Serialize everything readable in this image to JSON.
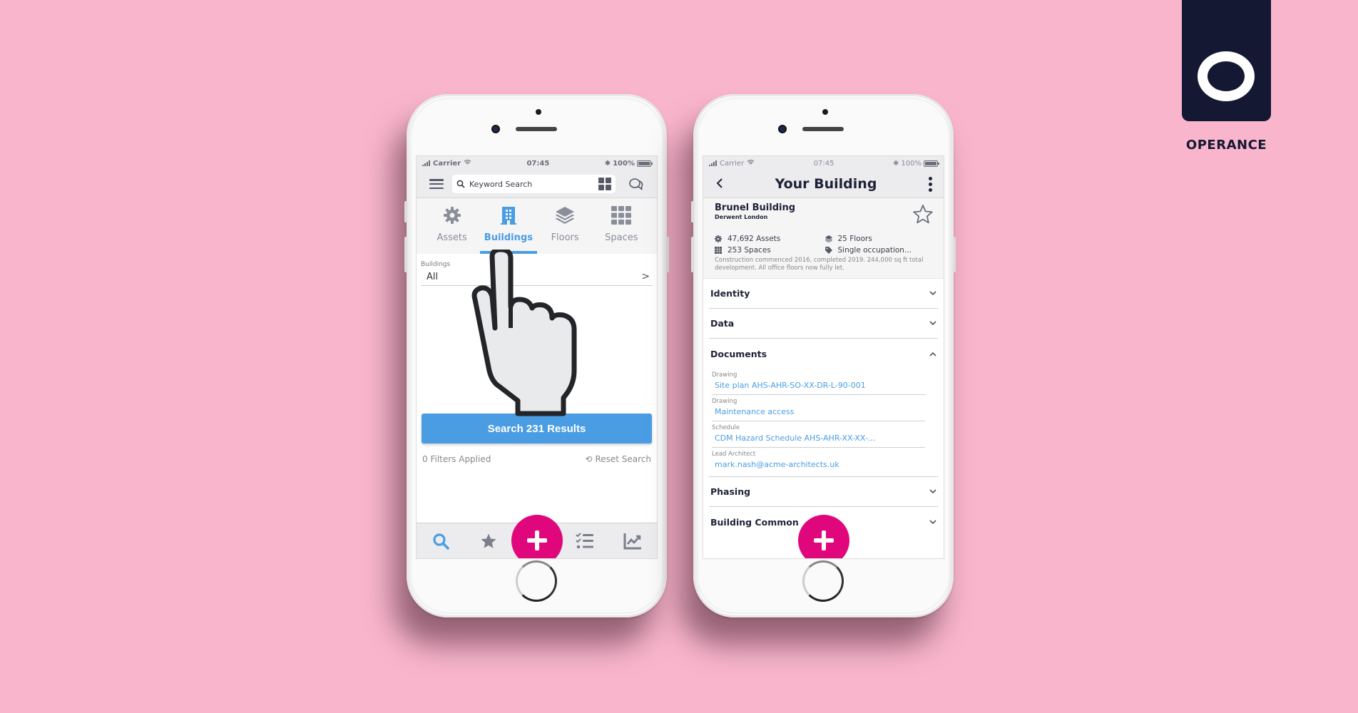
{
  "brand": {
    "name": "OPERANCE",
    "logo_color": "#141833",
    "background_color": "#f8b5cc"
  },
  "colors": {
    "accent": "#4a9de3",
    "fab": "#e0077d",
    "text_dark": "#1e2236"
  },
  "status_bar": {
    "carrier": "Carrier",
    "time": "07:45",
    "battery": "100%"
  },
  "left_phone": {
    "search": {
      "placeholder": "Keyword Search"
    },
    "category_tabs": [
      {
        "label": "Assets",
        "icon": "gear-icon",
        "active": false
      },
      {
        "label": "Buildings",
        "icon": "building-icon",
        "active": true
      },
      {
        "label": "Floors",
        "icon": "layers-icon",
        "active": false
      },
      {
        "label": "Spaces",
        "icon": "grid-icon",
        "active": false
      }
    ],
    "filter": {
      "label": "Buildings",
      "value": "All"
    },
    "search_button": "Search 231 Results",
    "filters_applied": "0 Filters Applied",
    "reset_search": "Reset Search",
    "bottom_nav": [
      {
        "icon": "search-icon",
        "active": true
      },
      {
        "icon": "star-icon",
        "active": false
      },
      {
        "icon": "plus-icon",
        "active": false
      },
      {
        "icon": "checklist-icon",
        "active": false
      },
      {
        "icon": "chart-icon",
        "active": false
      }
    ]
  },
  "right_phone": {
    "title": "Your Building",
    "building": {
      "name": "Brunel Building",
      "owner": "Derwent London",
      "stats": [
        {
          "icon": "gear-icon",
          "text": "47,692 Assets"
        },
        {
          "icon": "layers-icon",
          "text": "25 Floors"
        },
        {
          "icon": "grid-icon",
          "text": "253 Spaces"
        },
        {
          "icon": "tag-icon",
          "text": "Single occupation..."
        }
      ],
      "description": "Construction commenced 2016, completed 2019. 244,000 sq ft total development. All office floors now fully let."
    },
    "sections": [
      {
        "label": "Identity",
        "open": false
      },
      {
        "label": "Data",
        "open": false
      },
      {
        "label": "Documents",
        "open": true
      },
      {
        "label": "Phasing",
        "open": false
      },
      {
        "label": "Building Common",
        "open": false
      }
    ],
    "documents": [
      {
        "type": "Drawing",
        "value": "Site plan AHS-AHR-SO-XX-DR-L-90-001"
      },
      {
        "type": "Drawing",
        "value": "Maintenance access"
      },
      {
        "type": "Schedule",
        "value": "CDM Hazard Schedule AHS-AHR-XX-XX-..."
      },
      {
        "type": "Lead Architect",
        "value": "mark.nash@acme-architects.uk"
      }
    ]
  }
}
